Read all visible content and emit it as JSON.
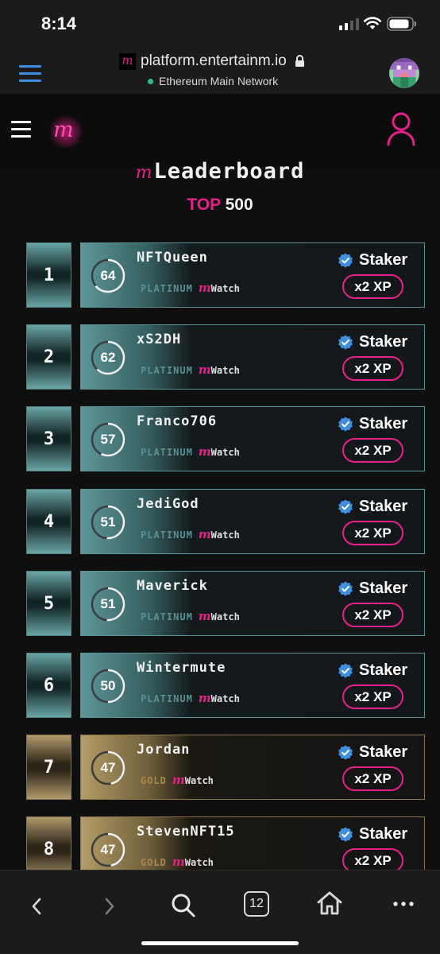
{
  "status_bar": {
    "time": "8:14"
  },
  "browser": {
    "url": "platform.entertainm.io",
    "favicon": "m",
    "network": "Ethereum Main Network"
  },
  "app": {
    "logo": "m"
  },
  "page": {
    "title_mark": "m",
    "title": "Leaderboard",
    "subtitle_accent": "TOP",
    "subtitle_number": "500"
  },
  "leaderboard": [
    {
      "rank": "1",
      "name": "NFTQueen",
      "score": "64",
      "progress": 0.64,
      "tier": "PLATINUM",
      "watch_mark": "m",
      "watch": "Watch",
      "badge": "Staker",
      "xp": "x2 XP"
    },
    {
      "rank": "2",
      "name": "xS2DH",
      "score": "62",
      "progress": 0.62,
      "tier": "PLATINUM",
      "watch_mark": "m",
      "watch": "Watch",
      "badge": "Staker",
      "xp": "x2 XP"
    },
    {
      "rank": "3",
      "name": "Franco706",
      "score": "57",
      "progress": 0.57,
      "tier": "PLATINUM",
      "watch_mark": "m",
      "watch": "Watch",
      "badge": "Staker",
      "xp": "x2 XP"
    },
    {
      "rank": "4",
      "name": "JediGod",
      "score": "51",
      "progress": 0.51,
      "tier": "PLATINUM",
      "watch_mark": "m",
      "watch": "Watch",
      "badge": "Staker",
      "xp": "x2 XP"
    },
    {
      "rank": "5",
      "name": "Maverick",
      "score": "51",
      "progress": 0.51,
      "tier": "PLATINUM",
      "watch_mark": "m",
      "watch": "Watch",
      "badge": "Staker",
      "xp": "x2 XP"
    },
    {
      "rank": "6",
      "name": "Wintermute",
      "score": "50",
      "progress": 0.5,
      "tier": "PLATINUM",
      "watch_mark": "m",
      "watch": "Watch",
      "badge": "Staker",
      "xp": "x2 XP"
    },
    {
      "rank": "7",
      "name": "Jordan",
      "score": "47",
      "progress": 0.47,
      "tier": "GOLD",
      "watch_mark": "m",
      "watch": "Watch",
      "badge": "Staker",
      "xp": "x2 XP"
    },
    {
      "rank": "8",
      "name": "StevenNFT15",
      "score": "47",
      "progress": 0.47,
      "tier": "GOLD",
      "watch_mark": "m",
      "watch": "Watch",
      "badge": "Staker",
      "xp": "x2 XP"
    }
  ],
  "bottom_bar": {
    "tab_count": "12"
  },
  "colors": {
    "accent": "#e5208a",
    "platinum": "#5e9799",
    "gold": "#b39c66",
    "verified": "#3f8fe0"
  }
}
